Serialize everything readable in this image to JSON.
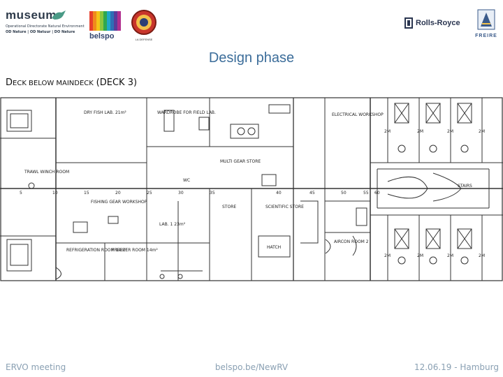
{
  "header": {
    "logos": {
      "museum": {
        "name": "museum",
        "line1": "Operational Directorate Natural Environment",
        "line2": "OD Nature | OD Natuur | DO Nature"
      },
      "belspo": {
        "name": "belspo"
      },
      "seal": {
        "name": "LA DEFENSE"
      },
      "rolls_royce": {
        "name": "Rolls-Royce"
      },
      "freire": {
        "name": "FREIRE"
      }
    }
  },
  "slide": {
    "title": "Design phase",
    "subtitle_d": "D",
    "subtitle_rest": "ECK BELOW MAINDECK",
    "subtitle_paren": "(DECK 3)"
  },
  "plan": {
    "rooms": {
      "dry_fish": "DRY FISH LAB. 21m²",
      "wardrobe": "WARDROBE FOR FIELD LAB.",
      "electrical_workshop": "ELECTRICAL WORKSHOP",
      "trawl_winch_room": "TRAWL WINCH ROOM",
      "multi_gear_store": "MULTI GEAR STORE",
      "fishing_gear_workshop": "FISHING GEAR WORKSHOP",
      "refrigeration_room": "REFRIGERATION ROOM 14m²",
      "freezer_room": "FREEZER ROOM 14m²",
      "lab": "LAB. 1 23m²",
      "oxygen_store": "SCIENTIFIC STORE",
      "store": "STORE",
      "aircon_room": "AIRCON ROOM 2",
      "hatch": "HATCH",
      "wc": "WC",
      "stairs": "STAIRS"
    },
    "frames": [
      "5",
      "10",
      "15",
      "20",
      "25",
      "30",
      "35",
      "40",
      "45",
      "50",
      "55",
      "60"
    ],
    "cabins": [
      "2M",
      "2M",
      "2M",
      "2M",
      "2M",
      "2M",
      "2M",
      "2M"
    ]
  },
  "footer": {
    "left": "ERVO meeting",
    "center": "belspo.be/NewRV",
    "right": "12.06.19 -  Hamburg"
  }
}
